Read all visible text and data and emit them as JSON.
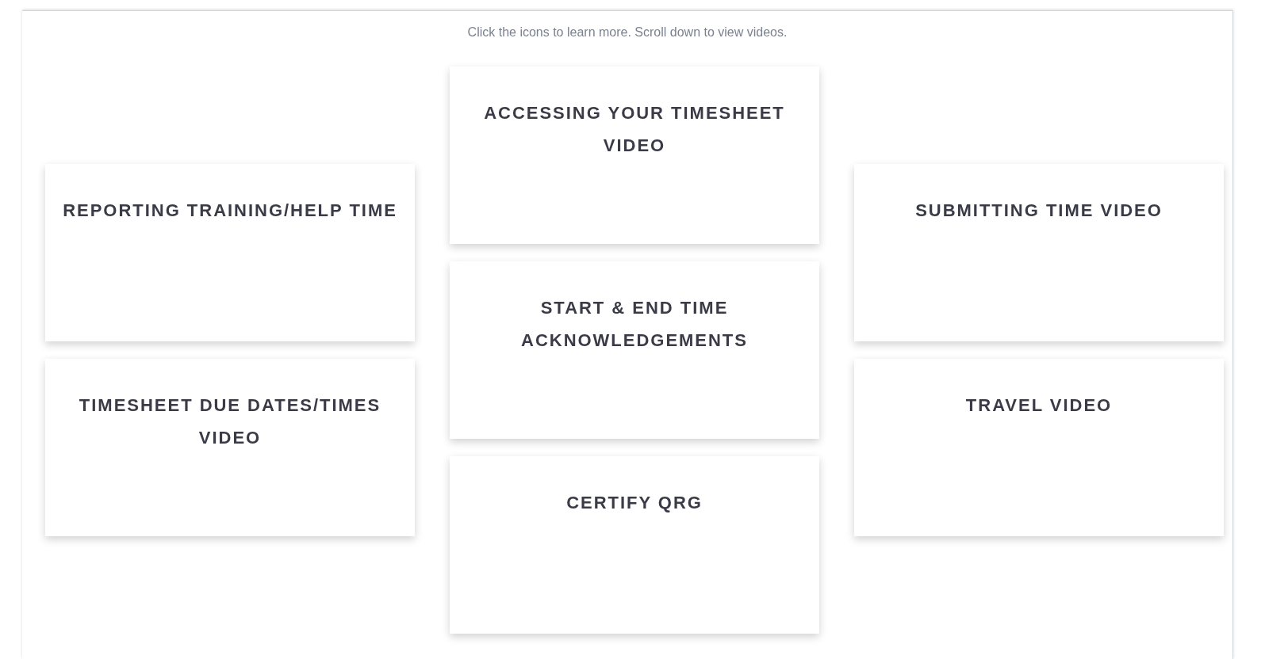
{
  "instructions": "Click the icons to learn more. Scroll down to view videos.",
  "columns": [
    {
      "cards": [
        {
          "title": "REPORTING TRAINING/HELP TIME"
        },
        {
          "title": "TIMESHEET DUE DATES/TIMES VIDEO"
        }
      ]
    },
    {
      "cards": [
        {
          "title": "ACCESSING YOUR TIMESHEET VIDEO"
        },
        {
          "title": "START & END TIME ACKNOWLEDGEMENTS"
        },
        {
          "title": "CERTIFY QRG"
        }
      ]
    },
    {
      "cards": [
        {
          "title": "SUBMITTING TIME VIDEO"
        },
        {
          "title": "TRAVEL VIDEO"
        }
      ]
    }
  ]
}
